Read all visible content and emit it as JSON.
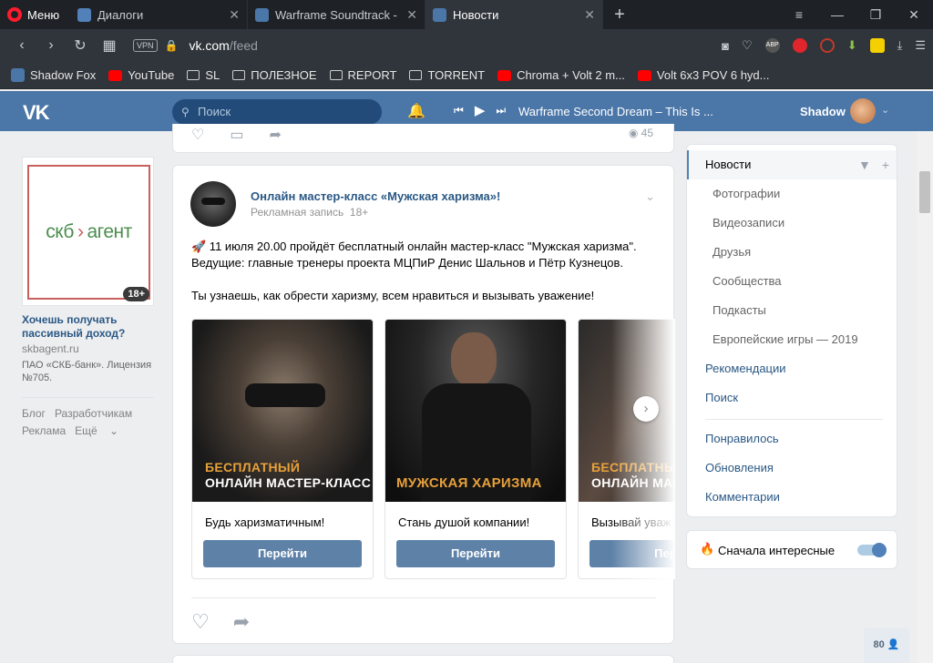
{
  "browser": {
    "menu_label": "Меню",
    "tabs": [
      {
        "title": "Диалоги",
        "icon": "vk-messages-icon",
        "active": false
      },
      {
        "title": "Warframe Soundtrack - Wir",
        "icon": "video-icon",
        "active": false
      },
      {
        "title": "Новости",
        "icon": "vk-icon",
        "active": true
      }
    ],
    "url_host": "vk.com",
    "url_path": "/feed",
    "vpn_label": "VPN",
    "abp_label": "ABP",
    "bookmarks": [
      {
        "label": "Shadow Fox",
        "icon": "vk-icon"
      },
      {
        "label": "YouTube",
        "icon": "youtube-icon"
      },
      {
        "label": "SL",
        "icon": "folder-icon"
      },
      {
        "label": "ПОЛЕЗНОЕ",
        "icon": "folder-icon"
      },
      {
        "label": "REPORT",
        "icon": "folder-icon"
      },
      {
        "label": "TORRENT",
        "icon": "folder-icon"
      },
      {
        "label": "Chroma + Volt 2 m...",
        "icon": "youtube-icon"
      },
      {
        "label": "Volt 6x3 POV 6 hyd...",
        "icon": "youtube-icon"
      }
    ]
  },
  "vk_header": {
    "logo": "VK",
    "search_placeholder": "Поиск",
    "track_title": "Warframe Second Dream – This Is ...",
    "username": "Shadow"
  },
  "ad": {
    "brand_left": "скб",
    "brand_arrow": "›",
    "brand_right": "агент",
    "age_badge": "18+",
    "title": "Хочешь получать пассивный доход?",
    "domain": "skbagent.ru",
    "legal": "ПАО «СКБ-банк». Лицензия №705."
  },
  "footer_links": [
    "Блог",
    "Разработчикам",
    "Реклама",
    "Ещё"
  ],
  "prev_post": {
    "views": "45"
  },
  "post": {
    "title": "Онлайн мастер-класс «Мужская харизма»!",
    "subtitle": "Рекламная запись",
    "age": "18+",
    "text_line1": "🚀 11 июля 20.00 пройдёт бесплатный онлайн мастер-класс \"Мужская харизма\".",
    "text_line2": "Ведущие: главные тренеры проекта МЦПиР Денис Шальнов и Пётр Кузнецов.",
    "text_line3": "Ты узнаешь, как обрести харизму, всем нравиться и вызывать уважение!",
    "carousel": [
      {
        "caption_line1": "БЕСПЛАТНЫЙ",
        "caption_line2": "ОНЛАЙН МАСТЕР-КЛАСС",
        "label": "Будь харизматичным!",
        "button": "Перейти"
      },
      {
        "caption_line1": "МУЖСКАЯ ХАРИЗМА",
        "caption_line2": "",
        "label": "Стань душой компании!",
        "button": "Перейти"
      },
      {
        "caption_line1": "БЕСПЛАТНЫЙ",
        "caption_line2": "ОНЛАЙН МАС",
        "label": "Вызывай уваж",
        "button": "Пере"
      }
    ]
  },
  "right_menu": {
    "items": [
      {
        "label": "Новости",
        "type": "active"
      },
      {
        "label": "Фотографии",
        "type": "sub"
      },
      {
        "label": "Видеозаписи",
        "type": "sub"
      },
      {
        "label": "Друзья",
        "type": "sub"
      },
      {
        "label": "Сообщества",
        "type": "sub"
      },
      {
        "label": "Подкасты",
        "type": "sub"
      },
      {
        "label": "Европейские игры — 2019",
        "type": "sub"
      },
      {
        "label": "Рекомендации",
        "type": "main"
      },
      {
        "label": "Поиск",
        "type": "main"
      }
    ],
    "items2": [
      {
        "label": "Понравилось"
      },
      {
        "label": "Обновления"
      },
      {
        "label": "Комментарии"
      }
    ]
  },
  "toggle": {
    "label": "Сначала интересные",
    "on": true
  },
  "online_badge": "80",
  "colors": {
    "vk_blue": "#4a76a8",
    "link": "#2a5885",
    "button": "#5e81a8",
    "opera_red": "#ff1b2d"
  }
}
